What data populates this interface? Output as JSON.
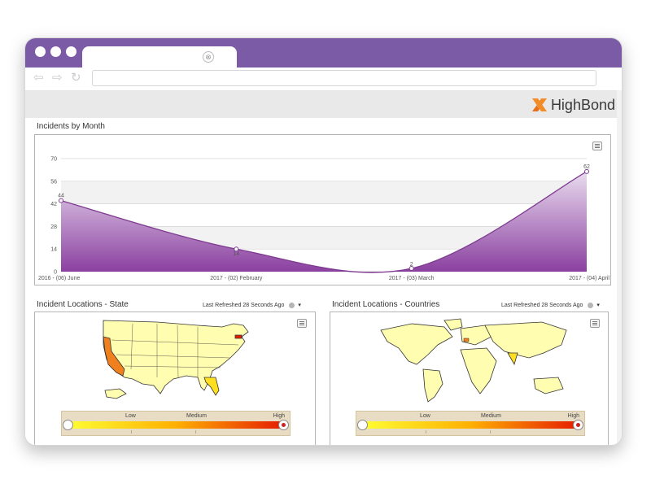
{
  "browser": {
    "tab_close": "⊗",
    "back_icon": "arrow-left-icon",
    "forward_icon": "arrow-right-icon",
    "reload_icon": "reload-icon",
    "url": ""
  },
  "app": {
    "logo_text": "HighBond",
    "logo_color": "#f28c28"
  },
  "incidents_by_month": {
    "title": "Incidents by Month"
  },
  "chart_data": {
    "type": "area",
    "title": "Incidents by Month",
    "x_labels": [
      "2016 - (06) June",
      "2017 - (02) February",
      "2017 - (03) March",
      "2017 - (04) April"
    ],
    "values": [
      44,
      14,
      2,
      62
    ],
    "y_ticks": [
      "0",
      "14",
      "28",
      "42",
      "56",
      "70"
    ],
    "ylim": [
      0,
      70
    ],
    "grid": true,
    "color": "#7e3b8f"
  },
  "state_panel": {
    "title": "Incident Locations - State",
    "refresh": "Last Refreshed 28 Seconds Ago",
    "legend": {
      "low": "Low",
      "medium": "Medium",
      "high": "High"
    }
  },
  "country_panel": {
    "title": "Incident Locations - Countries",
    "refresh": "Last Refreshed 28 Seconds Ago",
    "legend": {
      "low": "Low",
      "medium": "Medium",
      "high": "High"
    }
  },
  "colors": {
    "titlebar": "#7b5aa6",
    "map_fill": "#fffdb0",
    "map_high": "#f0801e",
    "map_mid": "#ffe021"
  }
}
